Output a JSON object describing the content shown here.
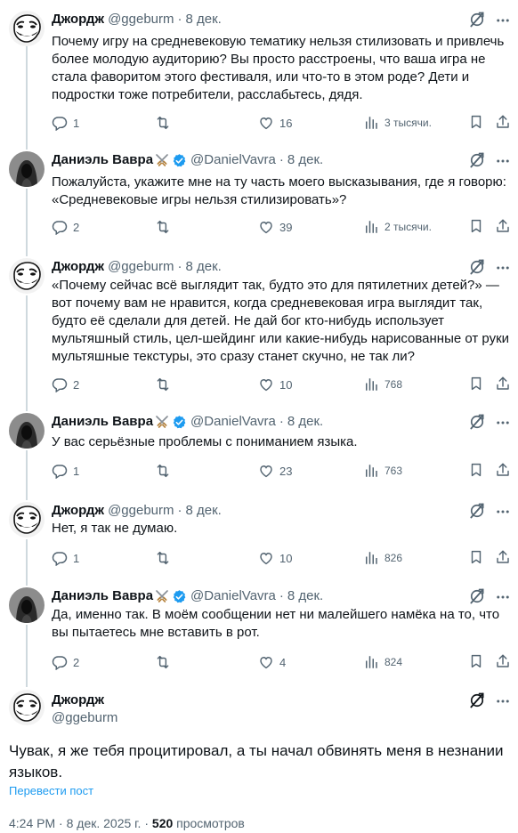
{
  "users": {
    "george": {
      "name": "Джордж",
      "handle": "@ggeburm"
    },
    "daniel": {
      "name": "Даниэль Вавра",
      "handle": "@DanielVavra"
    }
  },
  "tweets": [
    {
      "date": "8 дек.",
      "text": "Почему игру на средневековую тематику нельзя стилизовать и привлечь более молодую аудиторию? Вы просто расстроены, что ваша игра не стала фаворитом этого фестиваля, или что-то в этом роде? Дети и подростки тоже потребители, расслабьтесь, дядя.",
      "replies": "1",
      "likes": "16",
      "views": "3 тысячи."
    },
    {
      "date": "8 дек.",
      "text": "Пожалуйста, укажите мне на ту часть моего высказывания, где я говорю: «Средневековые игры нельзя стилизировать»?",
      "replies": "2",
      "likes": "39",
      "views": "2 тысячи."
    },
    {
      "date": "8 дек.",
      "text": "«Почему сейчас всё выглядит так, будто это для пятилетних детей?» — вот почему вам не нравится, когда средневековая игра выглядит так, будто её сделали для детей. Не дай бог кто-нибудь использует мультяшный стиль, цел-шейдинг или какие-нибудь нарисованные от руки мультяшные текстуры, это сразу станет скучно, не так ли?",
      "replies": "2",
      "likes": "10",
      "views": "768"
    },
    {
      "date": "8 дек.",
      "text": "У вас серьёзные проблемы с пониманием языка.",
      "replies": "1",
      "likes": "23",
      "views": "763"
    },
    {
      "date": "8 дек.",
      "text": "Нет, я так не думаю.",
      "replies": "1",
      "likes": "10",
      "views": "826"
    },
    {
      "date": "8 дек.",
      "text": "Да, именно так. В моём сообщении нет ни малейшего намёка на то, что вы пытаетесь мне вставить в рот.",
      "replies": "2",
      "likes": "4",
      "views": "824"
    }
  ],
  "main": {
    "text": "Чувак, я же тебя процитировал, а ты начал обвинять меня в незнании языков.",
    "translate": "Перевести пост",
    "time": "4:24 PM",
    "date": "8 дек. 2025 г.",
    "views_count": "520",
    "views_label": "просмотров"
  },
  "colors": {
    "accent": "#1d9bf0",
    "secondary": "#536471",
    "text": "#0f1419"
  }
}
